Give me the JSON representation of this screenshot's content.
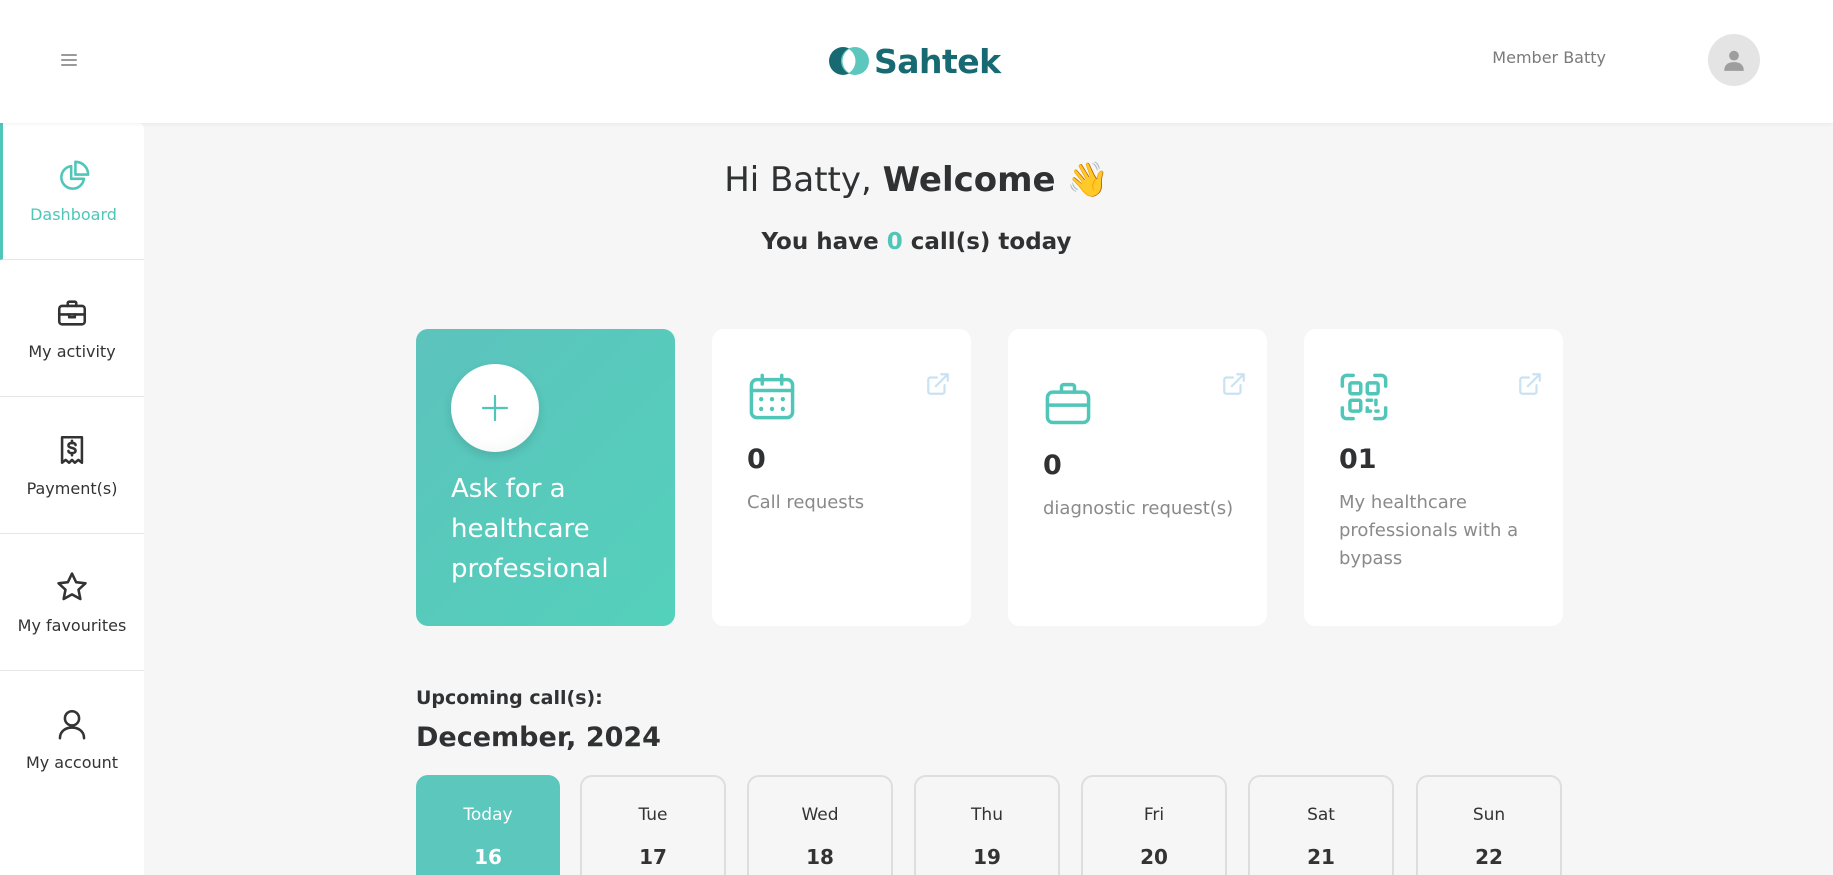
{
  "header": {
    "logo_text": "Sahtek",
    "user_name": "Member Batty"
  },
  "sidebar": {
    "items": [
      {
        "label": "Dashboard",
        "icon": "pie-chart-icon",
        "active": true
      },
      {
        "label": "My activity",
        "icon": "briefcase-icon"
      },
      {
        "label": "Payment(s)",
        "icon": "receipt-dollar-icon"
      },
      {
        "label": "My favourites",
        "icon": "star-icon"
      },
      {
        "label": "My account",
        "icon": "user-icon"
      }
    ]
  },
  "main": {
    "greeting": "Hi Batty,",
    "welcome": "Welcome",
    "emoji": "👋",
    "calls_prefix": "You have",
    "calls_count": "0",
    "calls_suffix": "call(s) today",
    "cards": {
      "ask": {
        "label": "Ask for a healthcare professional"
      },
      "call_requests": {
        "count": "0",
        "label": "Call requests",
        "icon": "calendar-icon"
      },
      "diagnostic": {
        "count": "0",
        "label": "diagnostic request(s)",
        "icon": "briefcase-icon"
      },
      "professionals": {
        "count": "01",
        "label": "My healthcare professionals with a bypass",
        "icon": "qr-code-icon"
      }
    },
    "upcoming_label": "Upcoming call(s):",
    "month": "December, 2024",
    "days": [
      {
        "name": "Today",
        "num": "16"
      },
      {
        "name": "Tue",
        "num": "17"
      },
      {
        "name": "Wed",
        "num": "18"
      },
      {
        "name": "Thu",
        "num": "19"
      },
      {
        "name": "Fri",
        "num": "20"
      },
      {
        "name": "Sat",
        "num": "21"
      },
      {
        "name": "Sun",
        "num": "22"
      }
    ]
  },
  "colors": {
    "accent": "#4fc6b8",
    "brand": "#176a72",
    "text": "#2f3133",
    "muted": "#8a8a8a"
  }
}
